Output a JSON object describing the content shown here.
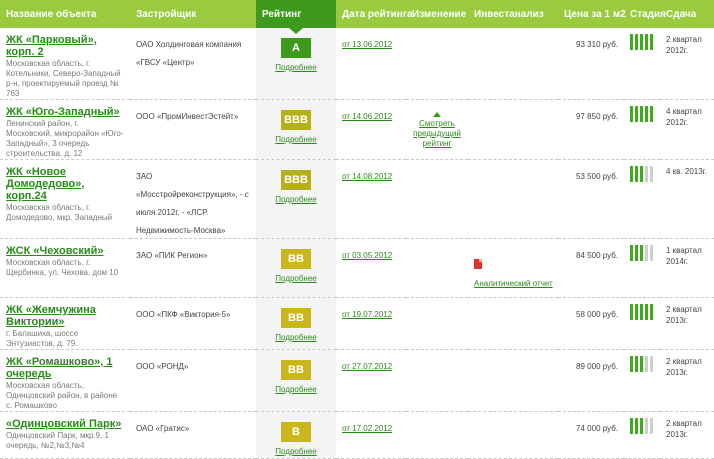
{
  "header": {
    "name": "Название объекта",
    "developer": "Застройщик",
    "rating": "Рейтинг",
    "date": "Дата рейтинга",
    "change": "Изменение",
    "invest": "Инвестанализ",
    "price": "Цена за 1 м2",
    "stage": "Стадия",
    "completion": "Сдача"
  },
  "colors": {
    "header_bg": "#9acb3f",
    "header_active_bg": "#3e9a1c",
    "link": "#2a8a1a",
    "badge_a": "#3e9a1c",
    "badge_bbb": "#b5b01a",
    "badge_bb": "#c9b71c",
    "badge_b": "#c9b71c",
    "stage_on": "#3eaa1c",
    "stage_off": "#cfcfcf"
  },
  "rows": [
    {
      "name": "ЖК «Парковый», корп. 2",
      "address": "Московская область, г. Котельники, Северо-Западный р-н, проектируемый проезд № 763",
      "developer": "ОАО Холдинговая компания «ГВСУ «Центр»",
      "rating": "A",
      "rating_color": "#3e9a1c",
      "more": "Подробнее",
      "date": "от 13.06.2012",
      "change": "",
      "invest": "",
      "price": "93 310 руб.",
      "stage": 5,
      "completion": "2 квартал 2012г."
    },
    {
      "name": "ЖК «Юго-Западный»",
      "address": "Ленинский район, г. Московский, микрорайон «Юго-Западный», 3 очередь строительства, д. 12",
      "developer": "ООО «ПромИнвестЭстейт»",
      "rating": "BBB",
      "rating_color": "#b5b01a",
      "more": "Подробнее",
      "date": "от 14.06.2012",
      "change": "Смотреть предыдущий рейтинг",
      "invest": "",
      "price": "97 850 руб.",
      "stage": 5,
      "completion": "4 квартал 2012г."
    },
    {
      "name": "ЖК «Новое Домодедово», корп.24",
      "address": "Московская область, г. Домодедово, мкр. Западный",
      "developer": "ЗАО «Мосстройреконструкция», - с июля 2012г. - «ЛСР. Недвижимость-Москва»",
      "rating": "BBB",
      "rating_color": "#b5b01a",
      "more": "Подробнее",
      "date": "от 14.08.2012",
      "change": "",
      "invest": "",
      "price": "53 500 руб.",
      "stage": 3,
      "completion": "4 кв. 2013г."
    },
    {
      "name": "ЖСК «Чеховский»",
      "address": "Московская область, г. Щербинка, ул. Чехова, дом 10",
      "developer": "ЗАО «ПИК Регион»",
      "rating": "BB",
      "rating_color": "#c9b71c",
      "more": "Подробнее",
      "date": "от 03.05.2012",
      "change": "",
      "invest": "Аналитический отчет",
      "price": "84 500 руб.",
      "stage": 3,
      "completion": "1 квартал 2014г."
    },
    {
      "name": "ЖК «Жемчужина Виктории»",
      "address": "г. Балашиха, шоссе Энтузиастов, д. 79.",
      "developer": "ООО «ПКФ «Виктория-5»",
      "rating": "BB",
      "rating_color": "#c9b71c",
      "more": "Подробнее",
      "date": "от 19.07.2012",
      "change": "",
      "invest": "",
      "price": "58 000 руб.",
      "stage": 5,
      "completion": "2 квартал 2013г."
    },
    {
      "name": "ЖК «Ромашково», 1 очередь",
      "address": "Московская область, Одинцовский район, в районе с. Ромашково",
      "developer": "ООО «РОНД»",
      "rating": "BB",
      "rating_color": "#c9b71c",
      "more": "Подробнее",
      "date": "от 27.07.2012",
      "change": "",
      "invest": "",
      "price": "89 000 руб.",
      "stage": 3,
      "completion": "2 квартал 2013г."
    },
    {
      "name": "«Одинцовский Парк»",
      "address": "Одинцовский Парк, мкр.9, 1 очередь, №2,№3,№4",
      "developer": "ОАО «Гратис»",
      "rating": "B",
      "rating_color": "#c9b71c",
      "more": "Подробнее",
      "date": "от 17.02.2012",
      "change": "",
      "invest": "",
      "price": "74 000 руб.",
      "stage": 3,
      "completion": "2 квартал 2013г."
    }
  ]
}
